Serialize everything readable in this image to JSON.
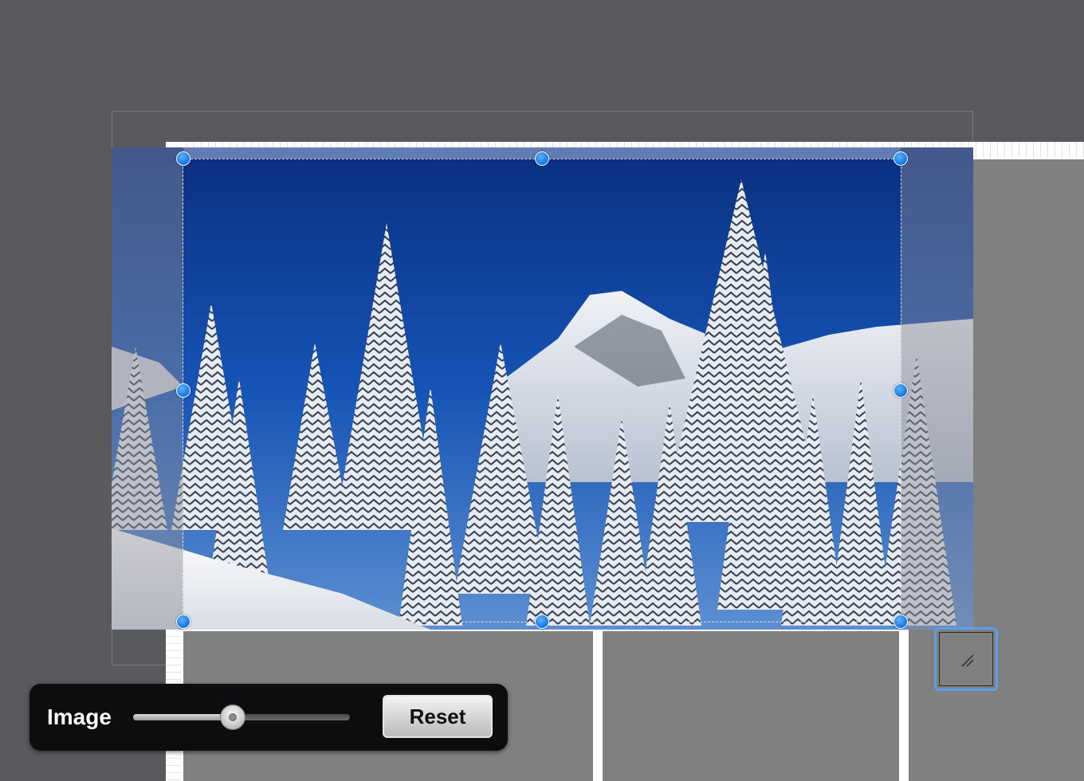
{
  "hud": {
    "label": "Image",
    "slider": {
      "value": 0.46
    },
    "reset_label": "Reset"
  },
  "colors": {
    "background": "#5a5a5e",
    "cell_gray": "#808080",
    "handle_blue": "#1a7de6",
    "sky_blue": "#0b3d94",
    "resize_border": "#5aa0e8"
  },
  "icons": {
    "resize_grip": "diagonal-lines-icon"
  }
}
